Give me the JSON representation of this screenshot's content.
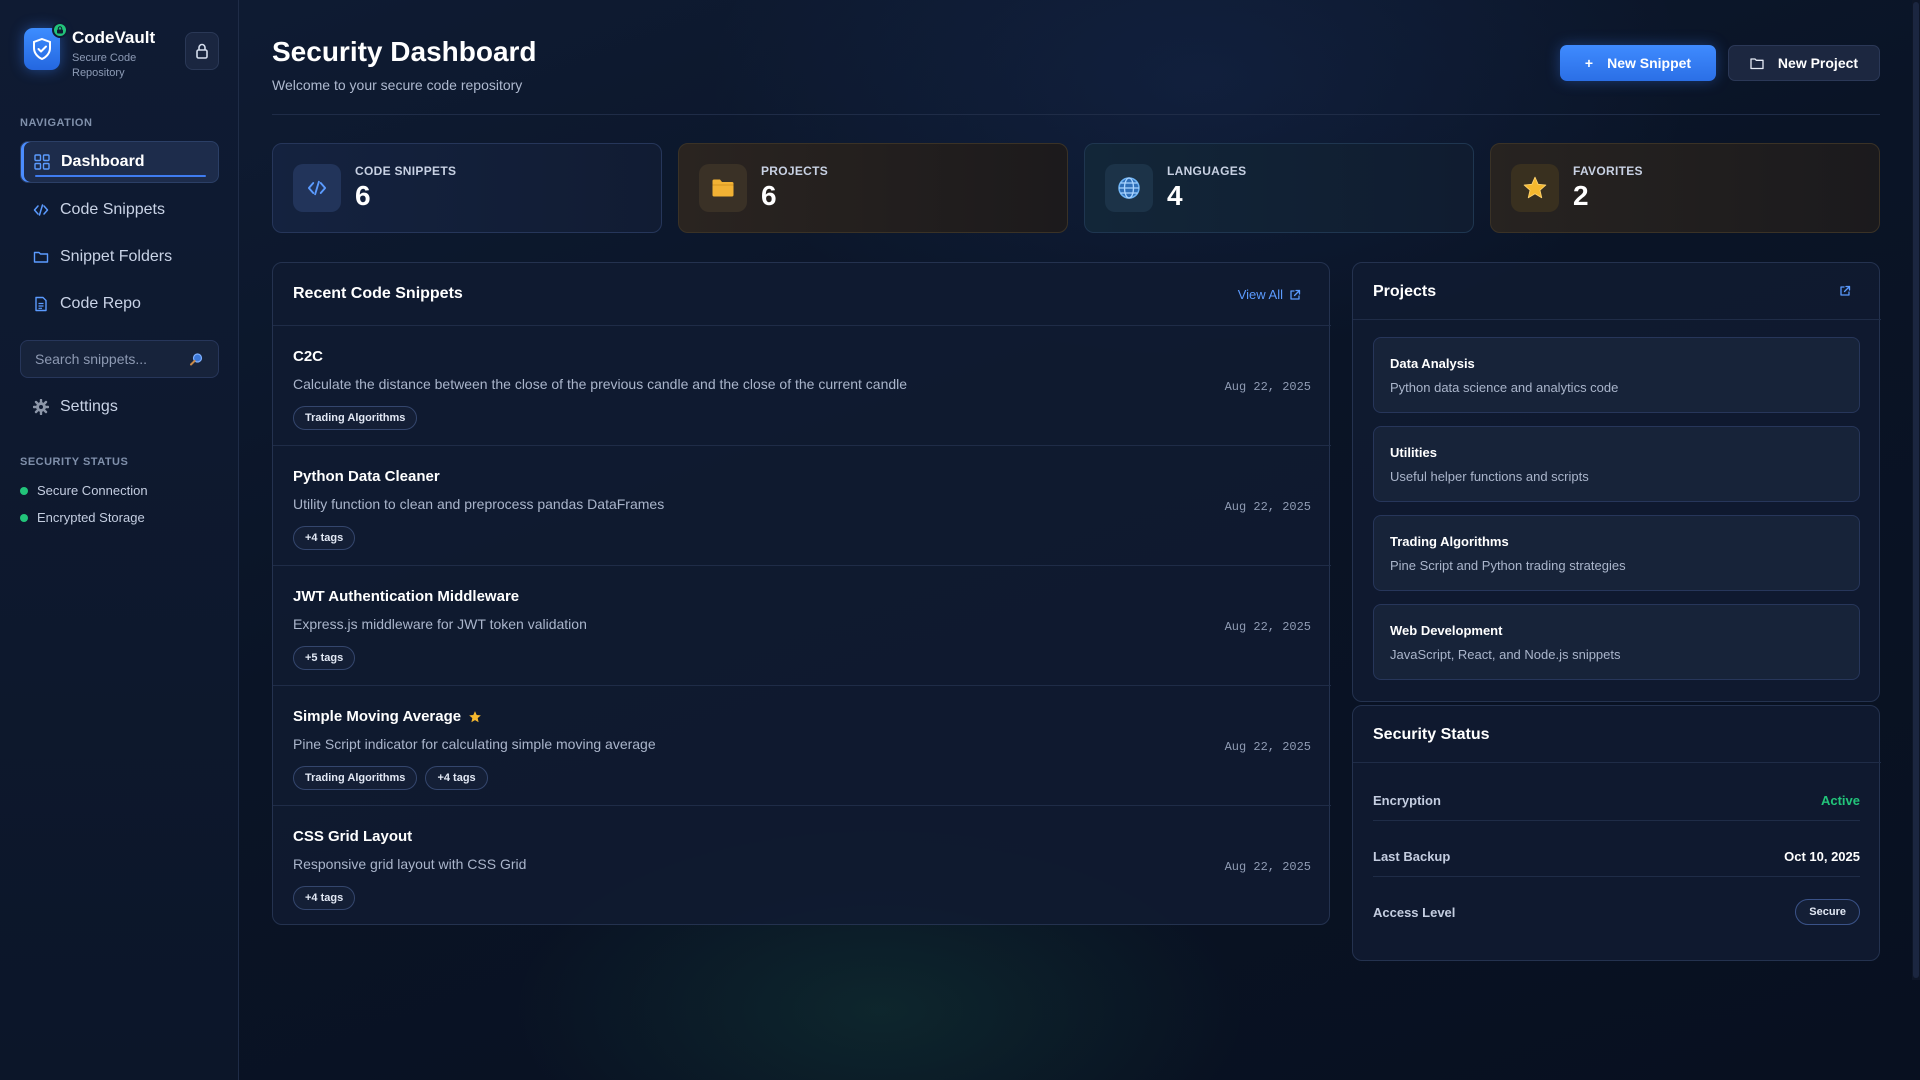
{
  "brand": {
    "name": "CodeVault",
    "subtitle": "Secure Code Repository"
  },
  "sidebar": {
    "nav_label": "NAVIGATION",
    "items": [
      {
        "label": "Dashboard",
        "icon": "grid-icon",
        "active": true
      },
      {
        "label": "Code Snippets",
        "icon": "code-icon"
      },
      {
        "label": "Snippet Folders",
        "icon": "folder-icon"
      },
      {
        "label": "Code Repo",
        "icon": "file-icon"
      }
    ],
    "search_placeholder": "Search snippets...",
    "settings_label": "Settings",
    "security_label": "SECURITY STATUS",
    "security_items": [
      "Secure Connection",
      "Encrypted Storage"
    ]
  },
  "header": {
    "title": "Security Dashboard",
    "subtitle": "Welcome to your secure code repository",
    "new_snippet": "New Snippet",
    "new_snippet_icon": "+",
    "new_project": "New Project"
  },
  "stats": [
    {
      "label": "CODE SNIPPETS",
      "value": "6",
      "icon": "code-icon"
    },
    {
      "label": "PROJECTS",
      "value": "6",
      "icon": "folder-icon"
    },
    {
      "label": "LANGUAGES",
      "value": "4",
      "icon": "globe-icon"
    },
    {
      "label": "FAVORITES",
      "value": "2",
      "icon": "star-icon"
    }
  ],
  "recent": {
    "title": "Recent Code Snippets",
    "view_all": "View All",
    "snippets": [
      {
        "title": "C2C",
        "desc": "Calculate the distance between the close of the previous candle and the close of the current candle",
        "date": "Aug 22, 2025",
        "tags": [
          "Trading Algorithms"
        ],
        "favorite": false
      },
      {
        "title": "Python Data Cleaner",
        "desc": "Utility function to clean and preprocess pandas DataFrames",
        "date": "Aug 22, 2025",
        "tags": [
          "+4 tags"
        ],
        "favorite": false
      },
      {
        "title": "JWT Authentication Middleware",
        "desc": "Express.js middleware for JWT token validation",
        "date": "Aug 22, 2025",
        "tags": [
          "+5 tags"
        ],
        "favorite": false
      },
      {
        "title": "Simple Moving Average",
        "desc": "Pine Script indicator for calculating simple moving average",
        "date": "Aug 22, 2025",
        "tags": [
          "Trading Algorithms",
          "+4 tags"
        ],
        "favorite": true
      },
      {
        "title": "CSS Grid Layout",
        "desc": "Responsive grid layout with CSS Grid",
        "date": "Aug 22, 2025",
        "tags": [
          "+4 tags"
        ],
        "favorite": false
      }
    ]
  },
  "projects": {
    "title": "Projects",
    "items": [
      {
        "name": "Data Analysis",
        "desc": "Python data science and analytics code"
      },
      {
        "name": "Utilities",
        "desc": "Useful helper functions and scripts"
      },
      {
        "name": "Trading Algorithms",
        "desc": "Pine Script and Python trading strategies"
      },
      {
        "name": "Web Development",
        "desc": "JavaScript, React, and Node.js snippets"
      }
    ]
  },
  "security": {
    "title": "Security Status",
    "encryption_label": "Encryption",
    "encryption_value": "Active",
    "backup_label": "Last Backup",
    "backup_value": "Oct 10, 2025",
    "access_label": "Access Level",
    "access_value": "Secure"
  },
  "colors": {
    "accent": "#3f8bff",
    "success": "#22c47a",
    "star": "#f5b82e"
  }
}
